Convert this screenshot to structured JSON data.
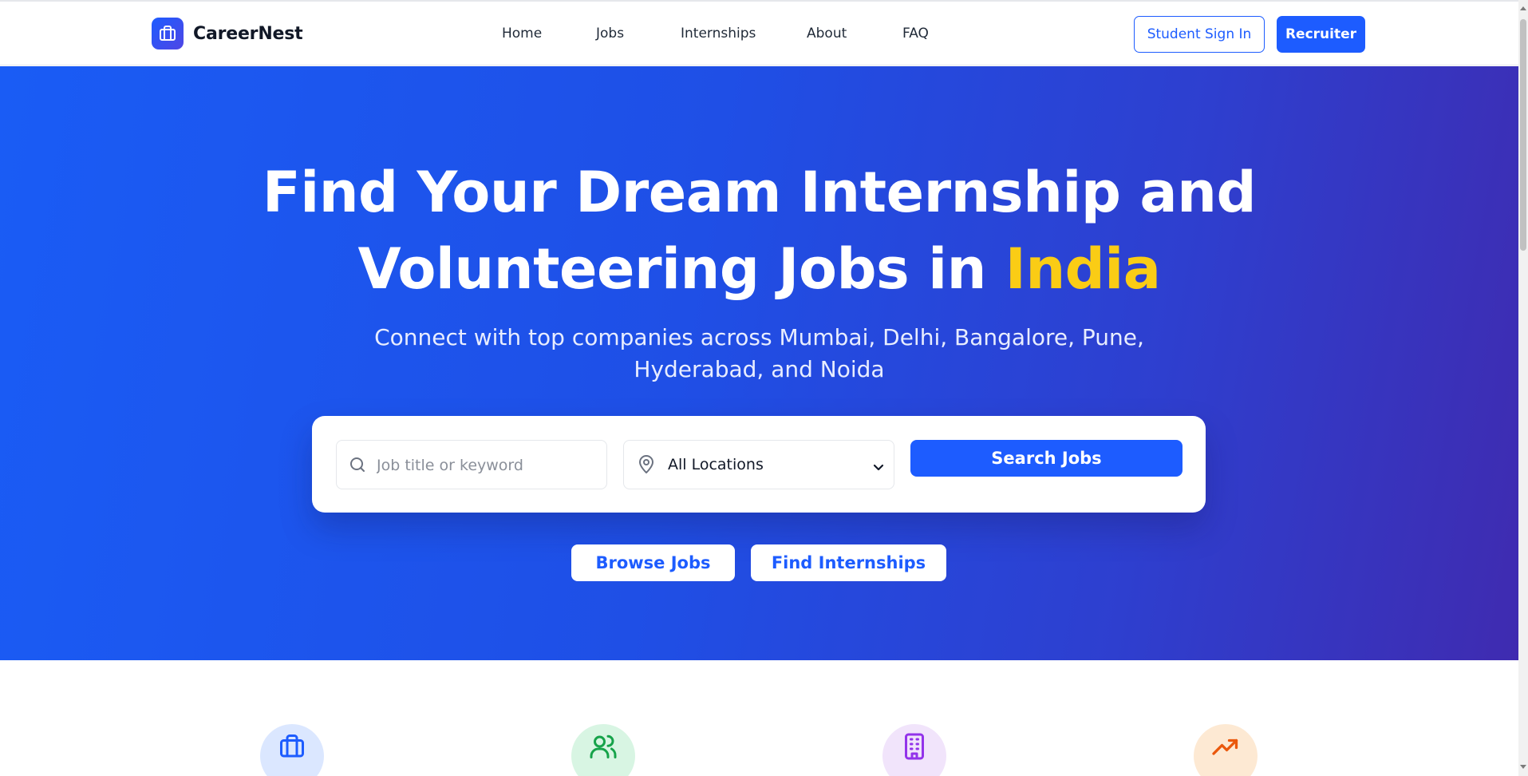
{
  "brand": {
    "name": "CareerNest",
    "logo_icon": "briefcase-icon"
  },
  "nav": {
    "links": [
      {
        "label": "Home"
      },
      {
        "label": "Jobs"
      },
      {
        "label": "Internships"
      },
      {
        "label": "About"
      },
      {
        "label": "FAQ"
      }
    ],
    "student_signin_label": "Student Sign In",
    "recruiter_label": "Recruiter"
  },
  "hero": {
    "title_line1": "Find Your Dream Internship and",
    "title_line2_prefix": "Volunteering Jobs in ",
    "title_accent": "India",
    "subtitle": "Connect with top companies across Mumbai, Delhi, Bangalore, Pune, Hyderabad, and Noida",
    "search": {
      "keyword_placeholder": "Job title or keyword",
      "keyword_value": "",
      "location_value": "All Locations",
      "button_label": "Search Jobs"
    },
    "browse_jobs_label": "Browse Jobs",
    "find_internships_label": "Find Internships"
  },
  "features": {
    "icons": [
      "briefcase-icon",
      "users-icon",
      "building-icon",
      "trending-up-icon"
    ]
  },
  "colors": {
    "primary": "#1d5cff",
    "accent": "#facc15",
    "hero_gradient_start": "#1a5cf5",
    "hero_gradient_end": "#3f2bb0"
  }
}
